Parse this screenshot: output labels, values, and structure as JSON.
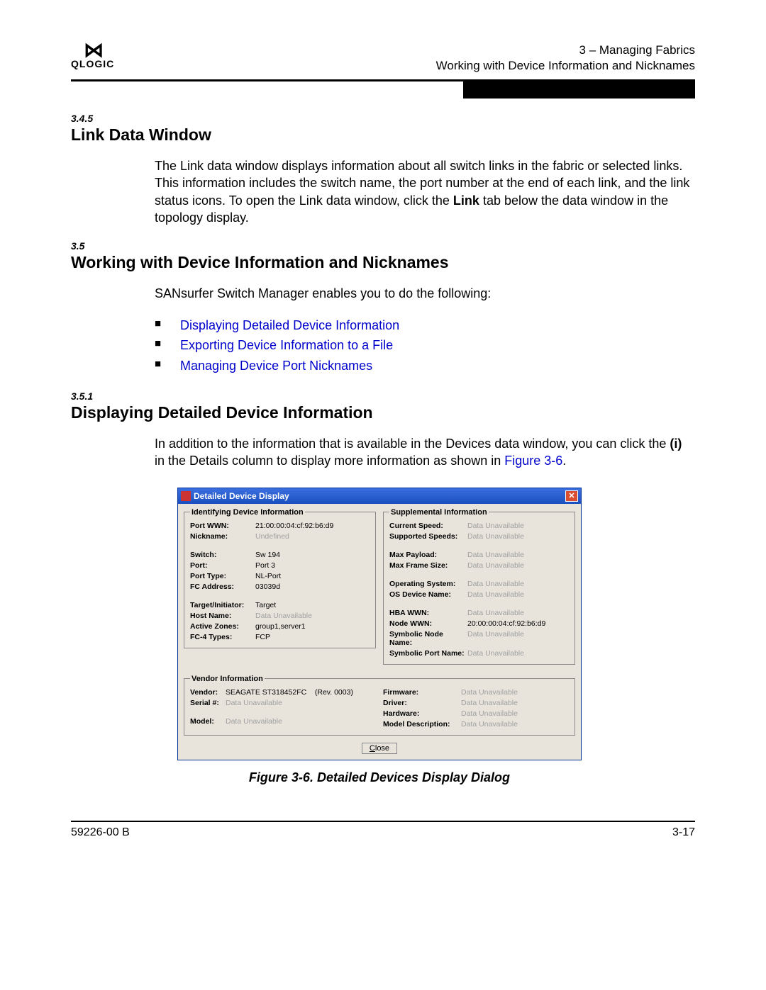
{
  "header": {
    "logo_text": "QLOGIC",
    "breadcrumb": "3 – Managing Fabrics",
    "subtitle": "Working with Device Information and Nicknames"
  },
  "sections": {
    "s345": {
      "num": "3.4.5",
      "title": "Link Data Window",
      "para_a": "The Link data window displays information about all switch links in the fabric or selected links. This information includes the switch name, the port number at the end of each link, and the link status icons. To open the Link data window, click the ",
      "link_word": "Link",
      "para_b": " tab below the data window in the topology display."
    },
    "s35": {
      "num": "3.5",
      "title": "Working with Device Information and Nicknames",
      "intro": "SANsurfer Switch Manager enables you to do the following:",
      "bullets": [
        "Displaying Detailed Device Information",
        "Exporting Device Information to a File",
        "Managing Device Port Nicknames"
      ]
    },
    "s351": {
      "num": "3.5.1",
      "title": "Displaying Detailed Device Information",
      "para_a": "In addition to the information that is available in the Devices data window, you can click the ",
      "para_b": "(i)",
      "para_c": " in the Details column to display more information as shown in ",
      "fig_ref": "Figure 3-6",
      "para_d": "."
    }
  },
  "dialog": {
    "title": "Detailed Device Display",
    "identifying_legend": "Identifying Device Information",
    "supplemental_legend": "Supplemental Information",
    "vendor_legend": "Vendor Information",
    "fields": {
      "port_wwn_k": "Port WWN:",
      "port_wwn_v": "21:00:00:04:cf:92:b6:d9",
      "nickname_k": "Nickname:",
      "nickname_v": "Undefined",
      "switch_k": "Switch:",
      "switch_v": "Sw 194",
      "port_k": "Port:",
      "port_v": "Port 3",
      "port_type_k": "Port Type:",
      "port_type_v": "NL-Port",
      "fc_addr_k": "FC Address:",
      "fc_addr_v": "03039d",
      "ti_k": "Target/Initiator:",
      "ti_v": "Target",
      "host_k": "Host Name:",
      "host_v": "Data Unavailable",
      "zones_k": "Active Zones:",
      "zones_v": "group1,server1",
      "fc4_k": "FC-4 Types:",
      "fc4_v": "FCP",
      "cspeed_k": "Current Speed:",
      "cspeed_v": "Data Unavailable",
      "sspeed_k": "Supported Speeds:",
      "sspeed_v": "Data Unavailable",
      "maxp_k": "Max Payload:",
      "maxp_v": "Data Unavailable",
      "maxf_k": "Max Frame Size:",
      "maxf_v": "Data Unavailable",
      "os_k": "Operating System:",
      "os_v": "Data Unavailable",
      "osdev_k": "OS Device Name:",
      "osdev_v": "Data Unavailable",
      "hba_k": "HBA WWN:",
      "hba_v": "Data Unavailable",
      "node_k": "Node WWN:",
      "node_v": "20:00:00:04:cf:92:b6:d9",
      "snn_k": "Symbolic Node Name:",
      "snn_v": "Data Unavailable",
      "spn_k": "Symbolic Port Name:",
      "spn_v": "Data Unavailable",
      "vendor_k": "Vendor:",
      "vendor_v": "SEAGATE ST318452FC",
      "vendor_rev": "(Rev. 0003)",
      "serial_k": "Serial #:",
      "serial_v": "Data Unavailable",
      "model_k": "Model:",
      "model_v": "Data Unavailable",
      "fw_k": "Firmware:",
      "fw_v": "Data Unavailable",
      "drv_k": "Driver:",
      "drv_v": "Data Unavailable",
      "hw_k": "Hardware:",
      "hw_v": "Data Unavailable",
      "mdesc_k": "Model Description:",
      "mdesc_v": "Data Unavailable"
    },
    "close_label": "Close"
  },
  "figure_caption": "Figure 3-6.  Detailed Devices Display Dialog",
  "footer": {
    "left": "59226-00 B",
    "right": "3-17"
  }
}
